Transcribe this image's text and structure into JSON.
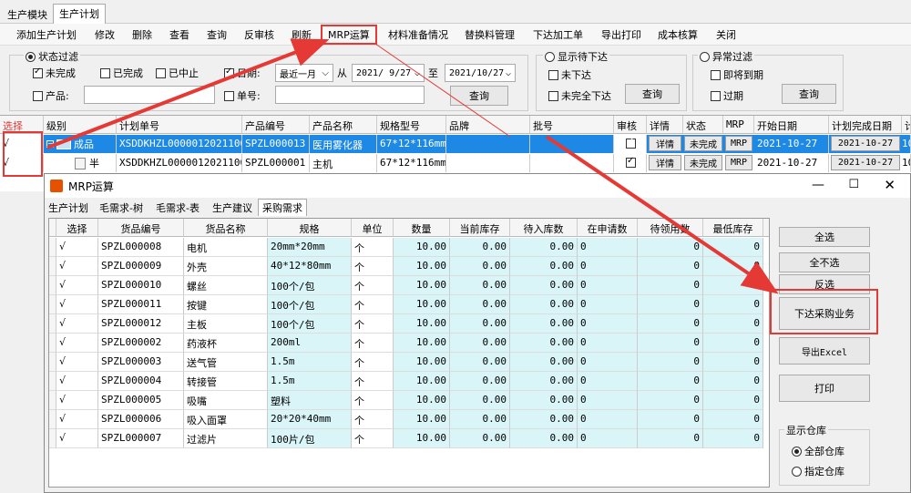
{
  "top_tabs": [
    "生产模块",
    "生产计划"
  ],
  "toolbar": [
    "添加生产计划",
    "修改",
    "删除",
    "查看",
    "查询",
    "反审核",
    "刷新",
    "MRP运算",
    "材料准备情况",
    "替换料管理",
    "下达加工单",
    "导出打印",
    "成本核算",
    "关闭"
  ],
  "filter": {
    "status_filter": "状态过滤",
    "not_done": "未完成",
    "done": "已完成",
    "stopped": "已中止",
    "date": "日期:",
    "period": "最近一月",
    "from": "从",
    "date_from": "2021/ 9/27",
    "to": "至",
    "date_to": "2021/10/27",
    "product": "产品:",
    "order_no": "单号:",
    "query": "查询",
    "show_pending": "显示待下达",
    "not_issued": "未下达",
    "not_fully_issued": "未完全下达",
    "abnormal_filter": "异常过滤",
    "due_soon": "即将到期",
    "overdue": "过期"
  },
  "grid": {
    "headers": [
      "选择",
      "级别",
      "计划单号",
      "产品编号",
      "产品名称",
      "规格型号",
      "品牌",
      "批号",
      "审核",
      "详情",
      "状态",
      "MRP",
      "开始日期",
      "计划完成日期",
      "计"
    ],
    "rows": [
      {
        "select": "√",
        "level": "成品",
        "order": "XSDDKHZL0000012021100...",
        "code": "SPZL000013",
        "name": "医用雾化器",
        "spec": "67*12*116mm",
        "detail": "详情",
        "status": "未完成",
        "mrp": "MRP",
        "start": "2021-10-27",
        "finish": "2021-10-27",
        "extra": "10"
      },
      {
        "select": "√",
        "level": "半",
        "order": "XSDDKHZL0000012021100...",
        "code": "SPZL000001",
        "name": "主机",
        "spec": "67*12*116mm",
        "detail": "详情",
        "status": "未完成",
        "mrp": "MRP",
        "start": "2021-10-27",
        "finish": "2021-10-27",
        "extra": "10"
      }
    ]
  },
  "dialog": {
    "title": "MRP运算",
    "tabs": [
      "生产计划",
      "毛需求-树",
      "毛需求-表",
      "生产建议",
      "采购需求"
    ],
    "headers": [
      "选择",
      "货品编号",
      "货品名称",
      "规格",
      "单位",
      "数量",
      "当前库存",
      "待入库数",
      "在申请数",
      "待领用数",
      "最低库存"
    ],
    "rows": [
      [
        "√",
        "SPZL000008",
        "电机",
        "20mm*20mm",
        "个",
        "10.00",
        "0.00",
        "0.00",
        "0",
        "0",
        "0"
      ],
      [
        "√",
        "SPZL000009",
        "外壳",
        "40*12*80mm",
        "个",
        "10.00",
        "0.00",
        "0.00",
        "0",
        "0",
        "0"
      ],
      [
        "√",
        "SPZL000010",
        "螺丝",
        "100个/包",
        "个",
        "10.00",
        "0.00",
        "0.00",
        "0",
        "0",
        "0"
      ],
      [
        "√",
        "SPZL000011",
        "按键",
        "100个/包",
        "个",
        "10.00",
        "0.00",
        "0.00",
        "0",
        "0",
        "0"
      ],
      [
        "√",
        "SPZL000012",
        "主板",
        "100个/包",
        "个",
        "10.00",
        "0.00",
        "0.00",
        "0",
        "0",
        "0"
      ],
      [
        "√",
        "SPZL000002",
        "药液杯",
        "200ml",
        "个",
        "10.00",
        "0.00",
        "0.00",
        "0",
        "0",
        "0"
      ],
      [
        "√",
        "SPZL000003",
        "送气管",
        "1.5m",
        "个",
        "10.00",
        "0.00",
        "0.00",
        "0",
        "0",
        "0"
      ],
      [
        "√",
        "SPZL000004",
        "转接管",
        "1.5m",
        "个",
        "10.00",
        "0.00",
        "0.00",
        "0",
        "0",
        "0"
      ],
      [
        "√",
        "SPZL000005",
        "吸嘴",
        "塑料",
        "个",
        "10.00",
        "0.00",
        "0.00",
        "0",
        "0",
        "0"
      ],
      [
        "√",
        "SPZL000006",
        "吸入面罩",
        "20*20*40mm",
        "个",
        "10.00",
        "0.00",
        "0.00",
        "0",
        "0",
        "0"
      ],
      [
        "√",
        "SPZL000007",
        "过滤片",
        "100片/包",
        "个",
        "10.00",
        "0.00",
        "0.00",
        "0",
        "0",
        "0"
      ]
    ],
    "buttons": [
      "全选",
      "全不选",
      "反选",
      "下达采购业务",
      "导出Excel",
      "打印"
    ],
    "warehouse": {
      "title": "显示仓库",
      "all": "全部仓库",
      "specified": "指定仓库"
    }
  },
  "colors": {
    "accent_blue": "#1e88e5",
    "highlight_red": "#e53935",
    "cell_cyan": "#d9f5f7"
  }
}
